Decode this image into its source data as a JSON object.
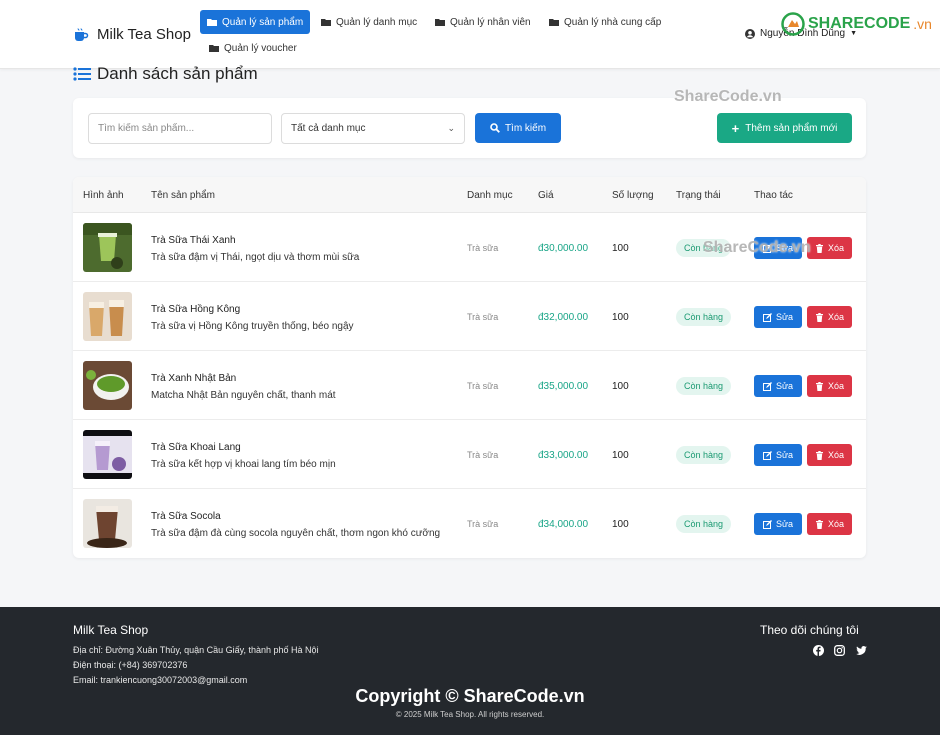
{
  "nav": {
    "brand": "Milk Tea Shop",
    "items": [
      {
        "label": "Quản lý sản phẩm",
        "active": true
      },
      {
        "label": "Quản lý danh mục",
        "active": false
      },
      {
        "label": "Quản lý nhân viên",
        "active": false
      },
      {
        "label": "Quản lý nhà cung cấp",
        "active": false
      },
      {
        "label": "Quản lý voucher",
        "active": false
      }
    ],
    "user": "Nguyễn Đình Dũng"
  },
  "watermark": {
    "logo_main": "SHARECODE",
    "logo_tld": ".vn",
    "text": "ShareCode.vn",
    "copyright": "Copyright © ShareCode.vn"
  },
  "page": {
    "title": "Danh sách sản phẩm"
  },
  "filters": {
    "search_placeholder": "Tìm kiếm sản phẩm...",
    "category_selected": "Tất cả danh mục",
    "search_button": "Tìm kiếm",
    "add_button": "Thêm sản phẩm mới"
  },
  "table": {
    "headers": [
      "Hình ảnh",
      "Tên sản phẩm",
      "Danh mục",
      "Giá",
      "Số lượng",
      "Trạng thái",
      "Thao tác"
    ],
    "edit_label": "Sửa",
    "delete_label": "Xóa",
    "rows": [
      {
        "name": "Trà Sữa Thái Xanh",
        "desc": "Trà sữa đậm vị Thái, ngọt dịu và thơm mùi sữa",
        "category": "Trà sữa",
        "price": "đ30,000.00",
        "qty": "100",
        "status": "Còn hàng",
        "image": "green-thai-tea"
      },
      {
        "name": "Trà Sữa Hồng Kông",
        "desc": "Trà sữa vị Hồng Kông truyền thống, béo ngậy",
        "category": "Trà sữa",
        "price": "đ32,000.00",
        "qty": "100",
        "status": "Còn hàng",
        "image": "hongkong-milk-tea"
      },
      {
        "name": "Trà Xanh Nhật Bản",
        "desc": "Matcha Nhật Bản nguyên chất, thanh mát",
        "category": "Trà sữa",
        "price": "đ35,000.00",
        "qty": "100",
        "status": "Còn hàng",
        "image": "matcha-bowl"
      },
      {
        "name": "Trà Sữa Khoai Lang",
        "desc": "Trà sữa kết hợp vị khoai lang tím béo mịn",
        "category": "Trà sữa",
        "price": "đ33,000.00",
        "qty": "100",
        "status": "Còn hàng",
        "image": "taro-milk-tea"
      },
      {
        "name": "Trà Sữa Socola",
        "desc": "Trà sữa đậm đà cùng socola nguyên chất, thơm ngon khó cưỡng",
        "category": "Trà sữa",
        "price": "đ34,000.00",
        "qty": "100",
        "status": "Còn hàng",
        "image": "chocolate-milk-tea"
      }
    ]
  },
  "footer": {
    "title": "Milk Tea Shop",
    "address": "Địa chỉ: Đường Xuân Thủy, quận Cầu Giấy, thành phố Hà Nội",
    "phone": "Điện thoại: (+84) 369702376",
    "email": "Email: trankiencuong30072003@gmail.com",
    "follow": "Theo dõi chúng tôi",
    "rights": "© 2025 Milk Tea Shop. All rights reserved."
  },
  "colors": {
    "primary": "#1a73d9",
    "success": "#1aa885",
    "danger": "#dc3545",
    "price": "#19a587",
    "footer_bg": "#24282d"
  }
}
